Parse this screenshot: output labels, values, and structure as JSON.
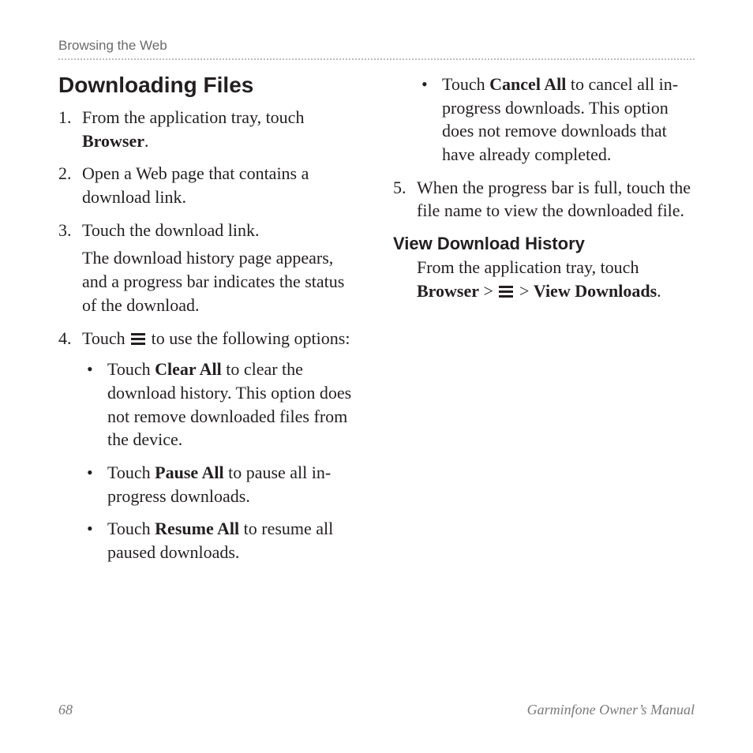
{
  "header": {
    "running": "Browsing the Web"
  },
  "section": {
    "title": "Downloading Files"
  },
  "steps_left": [
    {
      "num": "1.",
      "pre": "From the application tray, touch ",
      "bold": "Browser",
      "post": "."
    },
    {
      "num": "2.",
      "pre": "Open a Web page that contains a download link.",
      "bold": "",
      "post": ""
    },
    {
      "num": "3.",
      "pre": "Touch the download link.",
      "bold": "",
      "post": "",
      "after": "The download history page appears, and a progress bar indicates the status of the download."
    },
    {
      "num": "4.",
      "pre": "Touch ",
      "icon": true,
      "post": " to use the following options:",
      "bullets": [
        {
          "pre": "Touch ",
          "bold": "Clear All",
          "post": " to clear the download history. This option does not remove downloaded files from the device."
        },
        {
          "pre": "Touch ",
          "bold": "Pause All",
          "post": " to pause all in-progress downloads."
        },
        {
          "pre": "Touch ",
          "bold": "Resume All",
          "post": " to resume all paused downloads."
        }
      ]
    }
  ],
  "bullets_right": [
    {
      "pre": "Touch ",
      "bold": "Cancel All",
      "post": " to cancel all in-progress downloads. This option does not remove downloads that have already completed."
    }
  ],
  "step5": {
    "num": "5.",
    "text": "When the progress bar is full, touch the file name to view the downloaded file."
  },
  "sub": {
    "title": "View Download History",
    "pre": "From the application tray, touch ",
    "bold1": "Browser",
    "sep1": " > ",
    "sep2": " > ",
    "bold2": "View Downloads",
    "post": "."
  },
  "footer": {
    "page": "68",
    "manual": "Garminfone Owner’s Manual"
  }
}
